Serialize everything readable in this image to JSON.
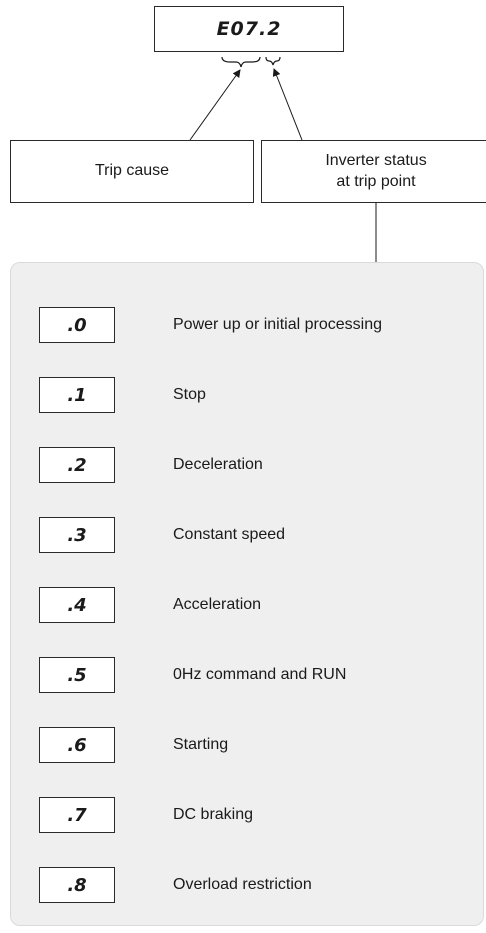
{
  "display_code": "E07.2",
  "trip_cause_label": "Trip cause",
  "inverter_status_label": [
    "Inverter status",
    "at trip point"
  ],
  "status_codes": [
    {
      "code": ".0",
      "description": "Power up or initial processing"
    },
    {
      "code": ".1",
      "description": "Stop"
    },
    {
      "code": ".2",
      "description": "Deceleration"
    },
    {
      "code": ".3",
      "description": "Constant speed"
    },
    {
      "code": ".4",
      "description": "Acceleration"
    },
    {
      "code": ".5",
      "description": "0Hz command and RUN"
    },
    {
      "code": ".6",
      "description": "Starting"
    },
    {
      "code": ".7",
      "description": "DC braking"
    },
    {
      "code": ".8",
      "description": "Overload restriction"
    }
  ]
}
